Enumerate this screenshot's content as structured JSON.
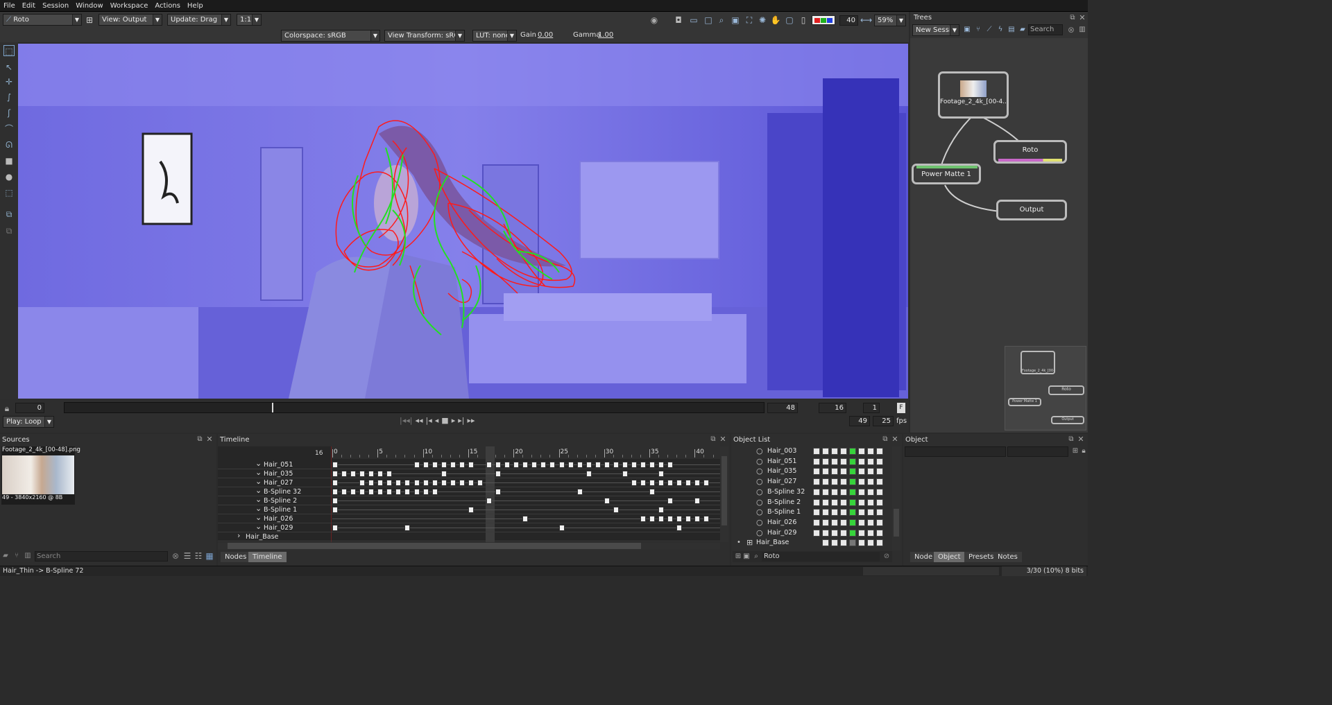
{
  "menu": [
    "File",
    "Edit",
    "Session",
    "Window",
    "Workspace",
    "Actions",
    "Help"
  ],
  "toolbar": {
    "tool": "Roto",
    "view": "View: Output",
    "update": "Update: Drag",
    "ratio": "1:1",
    "frame_box": "40",
    "zoom": "59%"
  },
  "toolbar2": {
    "colorspace": "Colorspace: sRGB",
    "view_transform": "View Transform: sRGB",
    "lut": "LUT: none",
    "gain_label": "Gain",
    "gain_value": "0.00",
    "gamma_label": "Gamma",
    "gamma_value": "1.00"
  },
  "playback": {
    "start": "0",
    "end": "48",
    "step": "16",
    "inc": "1",
    "f_label": "F",
    "mode": "Play: Loop",
    "current": "49",
    "fps": "25",
    "fps_label": "fps",
    "position": 0.297
  },
  "trees": {
    "title": "Trees",
    "session": "New Session",
    "search_placeholder": "Search",
    "nodes": {
      "footage": "Footage_2_4k_[00-4...",
      "roto": "Roto",
      "power_matte": "Power Matte 1",
      "output": "Output"
    },
    "mini": {
      "footage": "Footage_2_4k_[00-4...",
      "roto": "Roto",
      "power_matte": "Power Matte 1",
      "output": "Output"
    }
  },
  "sources": {
    "title": "Sources",
    "file": "Footage_2_4k_[00-48].png",
    "info": "49 - 3840x2160 @ 8B",
    "search_placeholder": "Search"
  },
  "timeline": {
    "title": "Timeline",
    "current_frame": "16",
    "ticks": [
      "0",
      "5",
      "10",
      "15",
      "20",
      "25",
      "30",
      "35",
      "40"
    ],
    "rows": [
      {
        "name": "Hair_051",
        "keys": [
          0,
          9,
          10,
          11,
          12,
          13,
          14,
          15,
          17,
          18,
          19,
          20,
          21,
          22,
          23,
          24,
          25,
          26,
          27,
          28,
          29,
          30,
          31,
          32,
          33,
          34,
          35,
          36,
          37
        ]
      },
      {
        "name": "Hair_035",
        "keys": [
          0,
          1,
          2,
          3,
          4,
          5,
          6,
          12,
          18,
          28,
          32,
          36
        ]
      },
      {
        "name": "Hair_027",
        "keys": [
          0,
          3,
          4,
          5,
          6,
          7,
          8,
          9,
          10,
          11,
          12,
          13,
          14,
          15,
          16,
          33,
          34,
          35,
          36,
          37,
          38,
          39,
          40,
          41
        ]
      },
      {
        "name": "B-Spline 32",
        "keys": [
          0,
          1,
          2,
          3,
          4,
          5,
          6,
          7,
          8,
          9,
          10,
          11,
          18,
          27,
          35
        ]
      },
      {
        "name": "B-Spline 2",
        "keys": [
          0,
          17,
          30,
          37,
          40
        ]
      },
      {
        "name": "B-Spline 1",
        "keys": [
          0,
          15,
          31,
          36
        ]
      },
      {
        "name": "Hair_026",
        "keys": [
          21,
          34,
          35,
          36,
          37,
          38,
          39,
          40,
          41
        ]
      },
      {
        "name": "Hair_029",
        "keys": [
          0,
          8,
          25,
          38
        ]
      },
      {
        "name": "Hair_Base",
        "keys": []
      }
    ],
    "tabs": {
      "nodes": "Nodes",
      "timeline": "Timeline"
    }
  },
  "object_list": {
    "title": "Object List",
    "items": [
      "Hair_003",
      "Hair_051",
      "Hair_035",
      "Hair_027",
      "B-Spline 32",
      "B-Spline 2",
      "B-Spline 1",
      "Hair_026",
      "Hair_029",
      "Hair_Base"
    ],
    "filter": "Roto"
  },
  "object": {
    "title": "Object",
    "tabs": [
      "Node",
      "Object",
      "Presets",
      "Notes"
    ]
  },
  "status": {
    "left": "Hair_Thin -> B-Spline 72",
    "right": "3/30 (10%) 8 bits"
  }
}
